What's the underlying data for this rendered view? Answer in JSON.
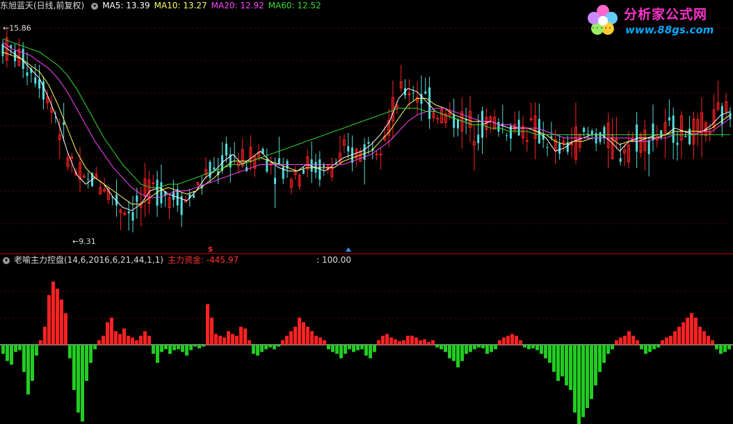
{
  "header": {
    "name": "东旭蓝天(日线,前复权)",
    "ma5": "MA5: 13.39",
    "ma10": "MA10: 13.27",
    "ma20": "MA20: 12.92",
    "ma60": "MA60: 12.52"
  },
  "indicator_header": {
    "name": "老喻主力控盘(14,6,2016,6,21,44,1,1)",
    "label": "主力资金: -445.97",
    "value": ": 100.00"
  },
  "annotations": {
    "high": "15.86",
    "low": "9.31",
    "marker_s": "S"
  },
  "logo": {
    "title": "分析家公式网",
    "url": "www.88gs.com"
  },
  "colors": {
    "up": "#ff2222",
    "down": "#22cc22",
    "ma5": "#ffffff",
    "ma10": "#ffff66",
    "ma20": "#ff44ff",
    "ma60": "#33dd33",
    "grid": "#7a0000",
    "divider": "#cc0000"
  },
  "chart_data": [
    {
      "type": "candlestick",
      "title": "东旭蓝天(日线,前复权)",
      "series": [
        {
          "name": "MA5",
          "values": [
            15.2,
            15.0,
            14.8,
            14.5,
            14.2,
            13.6,
            12.9,
            12.0,
            11.3,
            11.0,
            11.2,
            11.0,
            10.6,
            10.3,
            10.2,
            10.4,
            10.8,
            10.9,
            10.7,
            10.6,
            10.5,
            10.8,
            11.2,
            11.4,
            11.7,
            11.9,
            11.6,
            11.8,
            12.0,
            11.7,
            11.5,
            11.4,
            11.4,
            11.6,
            11.5,
            11.4,
            11.6,
            11.8,
            11.9,
            12.0,
            12.2,
            12.5,
            12.9,
            13.6,
            13.9,
            13.8,
            13.5,
            13.2,
            13.1,
            13.0,
            12.9,
            12.8,
            12.8,
            12.9,
            12.8,
            12.7,
            12.7,
            12.7,
            12.6,
            12.4,
            12.0,
            12.1,
            12.3,
            12.4,
            12.5,
            12.5,
            12.3,
            12.0,
            12.3,
            12.4,
            12.4,
            12.5,
            12.5,
            12.7,
            12.6,
            12.5,
            12.6,
            12.8,
            13.1,
            13.2
          ]
        },
        {
          "name": "MA10",
          "values": [
            15.0,
            14.9,
            14.8,
            14.6,
            14.4,
            14.0,
            13.4,
            12.7,
            12.0,
            11.5,
            11.2,
            11.0,
            10.8,
            10.6,
            10.4,
            10.4,
            10.6,
            10.8,
            10.9,
            10.8,
            10.7,
            10.8,
            11.0,
            11.2,
            11.5,
            11.7,
            11.7,
            11.7,
            11.8,
            11.7,
            11.6,
            11.5,
            11.4,
            11.5,
            11.5,
            11.5,
            11.5,
            11.7,
            11.8,
            11.9,
            12.0,
            12.3,
            12.6,
            13.0,
            13.4,
            13.6,
            13.6,
            13.4,
            13.3,
            13.1,
            13.0,
            12.9,
            12.9,
            12.9,
            12.8,
            12.8,
            12.7,
            12.7,
            12.6,
            12.5,
            12.3,
            12.2,
            12.3,
            12.3,
            12.4,
            12.4,
            12.4,
            12.2,
            12.3,
            12.3,
            12.4,
            12.4,
            12.5,
            12.6,
            12.6,
            12.6,
            12.6,
            12.7,
            12.9,
            13.1
          ]
        },
        {
          "name": "MA20",
          "values": [
            15.3,
            15.1,
            15.0,
            14.9,
            14.7,
            14.5,
            14.2,
            13.8,
            13.3,
            12.8,
            12.3,
            11.9,
            11.5,
            11.2,
            10.9,
            10.7,
            10.6,
            10.6,
            10.7,
            10.8,
            10.8,
            10.9,
            11.0,
            11.1,
            11.2,
            11.3,
            11.4,
            11.5,
            11.6,
            11.6,
            11.6,
            11.6,
            11.6,
            11.6,
            11.6,
            11.6,
            11.6,
            11.6,
            11.7,
            11.8,
            11.9,
            12.1,
            12.3,
            12.6,
            12.9,
            13.1,
            13.2,
            13.3,
            13.3,
            13.2,
            13.1,
            13.0,
            12.9,
            12.9,
            12.8,
            12.8,
            12.7,
            12.7,
            12.7,
            12.6,
            12.5,
            12.4,
            12.4,
            12.4,
            12.4,
            12.4,
            12.4,
            12.4,
            12.4,
            12.3,
            12.3,
            12.4,
            12.4,
            12.5,
            12.5,
            12.5,
            12.6,
            12.6,
            12.8,
            13.0
          ]
        },
        {
          "name": "MA60",
          "values": [
            15.4,
            15.3,
            15.2,
            15.1,
            15.0,
            14.8,
            14.6,
            14.3,
            13.9,
            13.4,
            12.9,
            12.4,
            12.0,
            11.6,
            11.3,
            11.0,
            10.9,
            10.9,
            11.0,
            11.0,
            11.1,
            11.2,
            11.3,
            11.4,
            11.5,
            11.6,
            11.6,
            11.7,
            11.8,
            11.9,
            12.0,
            12.1,
            12.2,
            12.3,
            12.4,
            12.5,
            12.6,
            12.7,
            12.8,
            12.9,
            13.0,
            13.1,
            13.2,
            13.3,
            13.3,
            13.3,
            13.2,
            13.2,
            13.1,
            13.0,
            12.9,
            12.8,
            12.8,
            12.7,
            12.7,
            12.6,
            12.6,
            12.6,
            12.5,
            12.5,
            12.5,
            12.5,
            12.5,
            12.5,
            12.5,
            12.5,
            12.5,
            12.5,
            12.5,
            12.5,
            12.5,
            12.5,
            12.5,
            12.5,
            12.5,
            12.5,
            12.5,
            12.5,
            12.5,
            12.5
          ]
        }
      ],
      "ylim": [
        9.0,
        16.2
      ],
      "high_label": "15.86",
      "low_label": "9.31"
    },
    {
      "type": "bar",
      "title": "老喻主力控盘(14,6,2016,6,21,44,1,1)",
      "series": [
        {
          "name": "主力资金",
          "values": [
            -10,
            -18,
            -22,
            -8,
            -6,
            -30,
            -55,
            -40,
            -12,
            5,
            20,
            55,
            70,
            62,
            50,
            35,
            -15,
            -50,
            -75,
            -85,
            -40,
            -20,
            -5,
            5,
            10,
            25,
            30,
            15,
            12,
            18,
            10,
            8,
            5,
            10,
            15,
            10,
            -10,
            -20,
            -8,
            -5,
            -10,
            -6,
            -5,
            -8,
            -12,
            -6,
            -2,
            -4,
            -2,
            45,
            30,
            12,
            10,
            8,
            15,
            12,
            10,
            20,
            18,
            5,
            -10,
            -12,
            -8,
            -5,
            -3,
            -5,
            -2,
            5,
            10,
            15,
            20,
            30,
            25,
            20,
            15,
            10,
            8,
            5,
            -5,
            -8,
            -10,
            -15,
            -10,
            -5,
            -8,
            -6,
            -5,
            -12,
            -15,
            -8,
            5,
            10,
            12,
            8,
            6,
            4,
            5,
            10,
            10,
            8,
            5,
            6,
            3,
            5,
            -3,
            -5,
            -8,
            -15,
            -18,
            -25,
            -18,
            -10,
            -8,
            -5,
            -3,
            -4,
            -10,
            -8,
            -5,
            5,
            8,
            10,
            12,
            10,
            5,
            -3,
            -5,
            -4,
            -6,
            -10,
            -15,
            -20,
            -30,
            -40,
            -35,
            -45,
            -50,
            -75,
            -90,
            -80,
            -70,
            -60,
            -45,
            -30,
            -20,
            -10,
            -5,
            5,
            8,
            10,
            15,
            10,
            5,
            -5,
            -10,
            -8,
            -5,
            -3,
            5,
            8,
            10,
            15,
            20,
            25,
            30,
            35,
            30,
            20,
            15,
            10,
            5,
            -5,
            -10,
            -8,
            -5
          ]
        }
      ]
    }
  ]
}
